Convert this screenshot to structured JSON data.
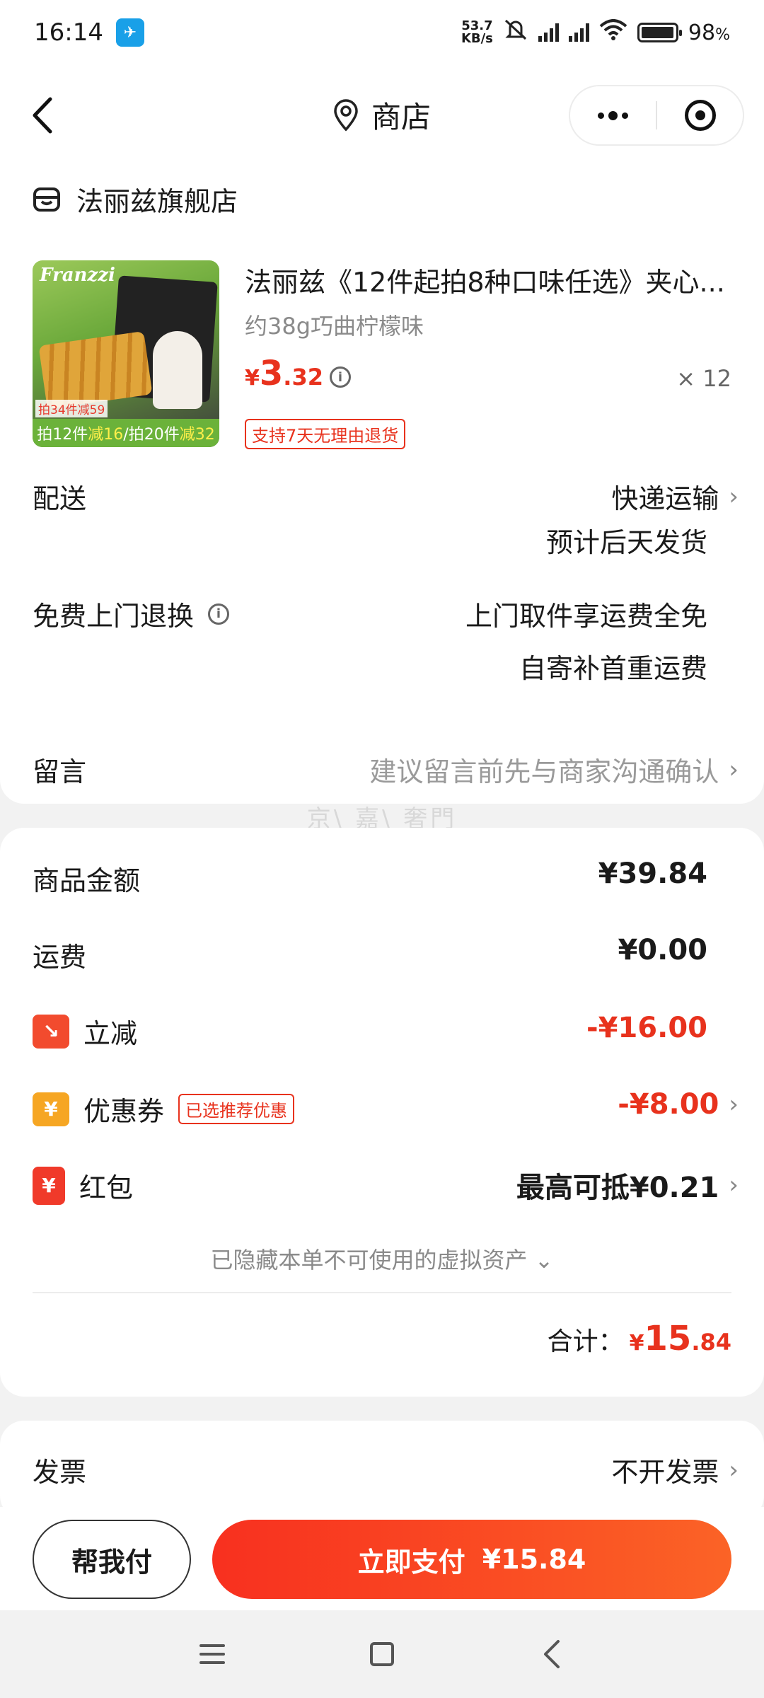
{
  "status_bar": {
    "time": "16:14",
    "net_speed_value": "53.7",
    "net_speed_unit": "KB/s",
    "battery": "98",
    "battery_unit": "%",
    "battery_level": 0.98
  },
  "header": {
    "title": "商店"
  },
  "shop": {
    "name": "法丽兹旗舰店"
  },
  "product": {
    "image_brand": "Franzzi",
    "image_promo_1": "拍34件减59",
    "image_promo_2_parts": [
      "拍12件",
      "减16",
      "/拍20件",
      "减32"
    ],
    "title": "法丽兹《12件起拍8种口味任选》夹心...",
    "variant": "约38g巧曲柠檬味",
    "price_currency": "¥",
    "price_int": "3",
    "price_dec": ".32",
    "quantity": "× 12",
    "return_tag": "支持7天无理由退货"
  },
  "delivery": {
    "label": "配送",
    "method": "快递运输",
    "eta": "预计后天发货"
  },
  "free_return": {
    "label": "免费上门退换",
    "line1": "上门取件享运费全免",
    "line2": "自寄补首重运费"
  },
  "message": {
    "label": "留言",
    "placeholder": "建议留言前先与商家沟通确认"
  },
  "watermark": "京\\ 嘉\\ 奢門",
  "fees": {
    "goods_label": "商品金额",
    "goods_value": "¥39.84",
    "shipping_label": "运费",
    "shipping_value": "¥0.00",
    "instant_label": "立减",
    "instant_value": "-¥16.00",
    "coupon_label": "优惠券",
    "coupon_tag": "已选推荐优惠",
    "coupon_value": "-¥8.00",
    "hongbao_label": "红包",
    "hongbao_value": "最高可抵¥0.21",
    "hidden_assets": "已隐藏本单不可使用的虚拟资产 ⌄",
    "total_label": "合计：",
    "total_currency": "¥",
    "total_int": "15",
    "total_dec": ".84"
  },
  "invoice": {
    "label": "发票",
    "value": "不开发票"
  },
  "actions": {
    "help_pay": "帮我付",
    "pay_now": "立即支付",
    "pay_amount": "¥15.84"
  },
  "colors": {
    "accent_red": "#e8321d",
    "pay_gradient_start": "#f8301f",
    "pay_gradient_end": "#fb6326"
  }
}
